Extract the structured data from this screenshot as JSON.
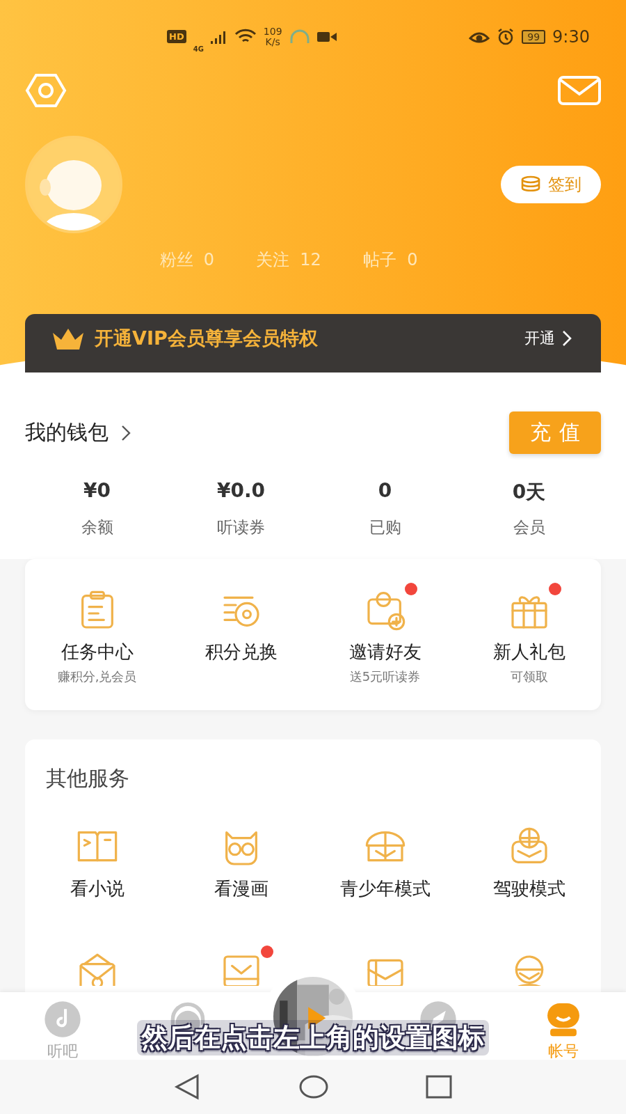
{
  "status_bar": {
    "hd_badge": "HD",
    "network_type": "4G",
    "network_speed": "109",
    "speed_unit": "K/s",
    "battery": "99",
    "time": "9:30"
  },
  "header": {
    "checkin_button": "签到",
    "stats": [
      {
        "label": "粉丝",
        "value": "0"
      },
      {
        "label": "关注",
        "value": "12"
      },
      {
        "label": "帖子",
        "value": "0"
      }
    ]
  },
  "vip_banner": {
    "text": "开通VIP会员尊享会员特权",
    "action": "开通"
  },
  "wallet": {
    "title": "我的钱包",
    "recharge_button": "充值",
    "items": [
      {
        "value": "¥0",
        "label": "余额"
      },
      {
        "value": "¥0.0",
        "label": "听读券"
      },
      {
        "value": "0",
        "label": "已购"
      },
      {
        "value": "0天",
        "label": "会员"
      }
    ]
  },
  "features": [
    {
      "label": "任务中心",
      "sublabel": "赚积分,兑会员",
      "badge": false
    },
    {
      "label": "积分兑换",
      "badge": false
    },
    {
      "label": "邀请好友",
      "sublabel": "送5元听读券",
      "badge": true
    },
    {
      "label": "新人礼包",
      "sublabel": "可领取",
      "badge": true
    }
  ],
  "services": {
    "title": "其他服务",
    "items": [
      {
        "label": "看小说",
        "badge": false
      },
      {
        "label": "看漫画",
        "badge": false
      },
      {
        "label": "青少年模式",
        "badge": false
      },
      {
        "label": "驾驶模式",
        "badge": false
      },
      {
        "badge": false
      },
      {
        "badge": true
      },
      {
        "badge": false
      },
      {
        "badge": false
      }
    ]
  },
  "bottom_nav": [
    {
      "kind": "tab",
      "label": "听吧",
      "selected": false
    },
    {
      "kind": "tab",
      "selected": false
    },
    {
      "kind": "player"
    },
    {
      "kind": "tab",
      "selected": false
    },
    {
      "kind": "tab",
      "label": "帐号",
      "selected": true
    }
  ],
  "caption": "然后在点击左上角的设置图标"
}
